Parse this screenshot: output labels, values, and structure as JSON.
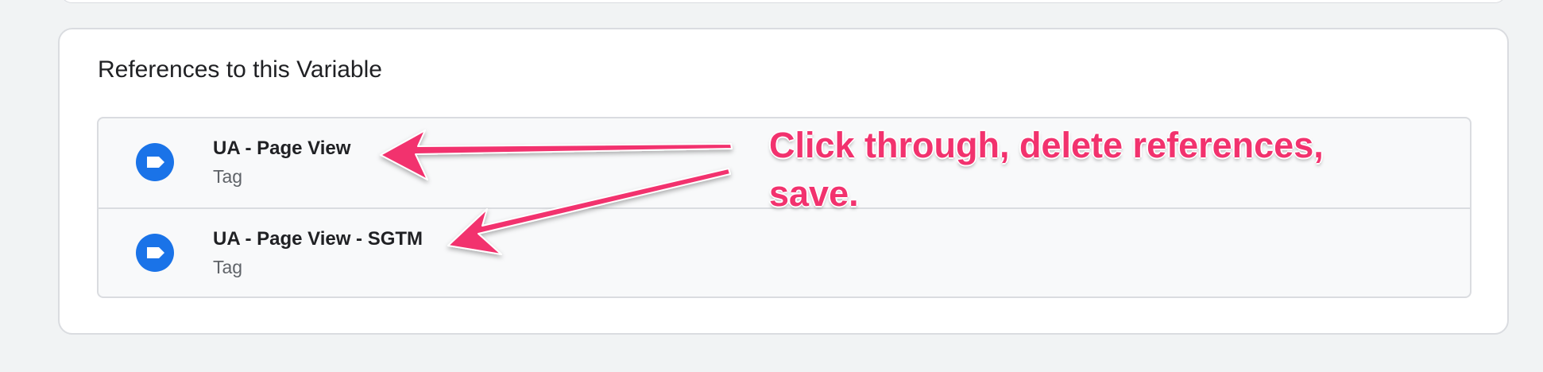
{
  "section": {
    "title": "References to this Variable"
  },
  "references": [
    {
      "title": "UA - Page View",
      "type": "Tag",
      "icon": "tag-icon"
    },
    {
      "title": "UA - Page View - SGTM",
      "type": "Tag",
      "icon": "tag-icon"
    }
  ],
  "annotation": {
    "text": "Click through, delete references, save.",
    "color": "#f2326e"
  },
  "colors": {
    "background": "#f1f3f4",
    "card": "#ffffff",
    "list_background": "#f8f9fa",
    "border": "#dadce0",
    "icon": "#1a73e8"
  }
}
